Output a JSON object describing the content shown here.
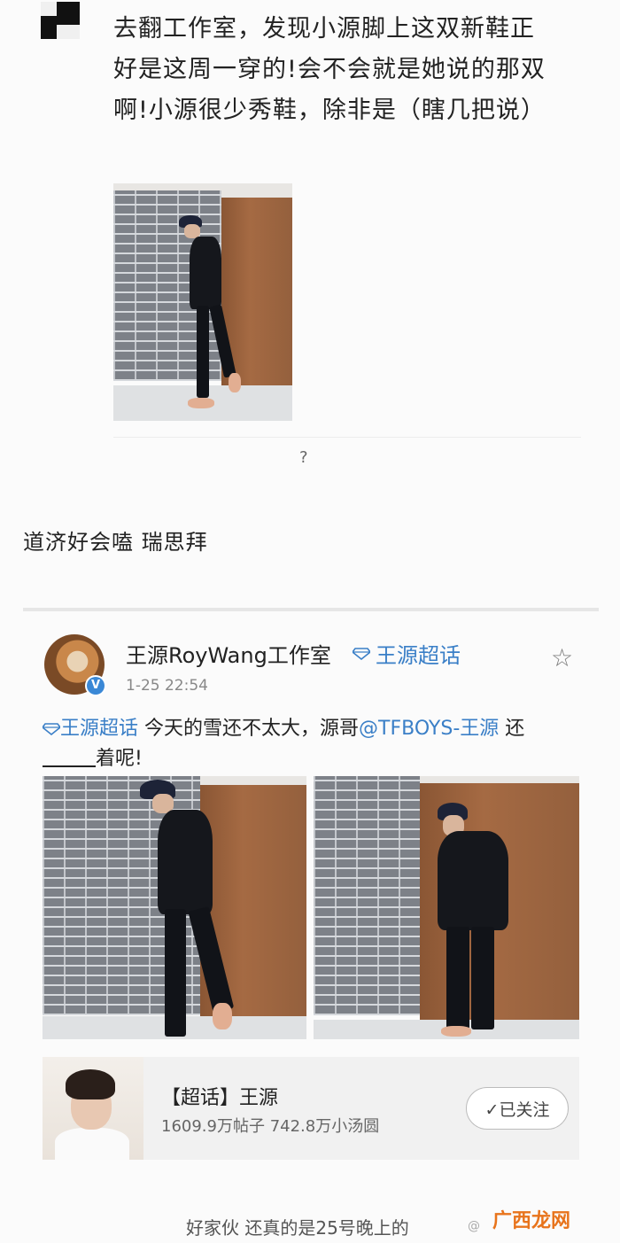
{
  "post": {
    "text": "去翻工作室，发现小源脚上这双新鞋正好是这周一穿的!会不会就是她说的那双啊!小源很少秀鞋，除非是（瞎几把说）",
    "question_mark": "?"
  },
  "comment": {
    "text": "道济好会嗑 瑞思拜"
  },
  "card": {
    "author": "王源RoyWang工作室",
    "topic_label": "王源超话",
    "time": "1-25 22:54",
    "verified_mark": "V",
    "star_glyph": "☆",
    "text_topic": "王源超话",
    "text_part1": " 今天的雪还不太大，源哥",
    "text_mention": "@TFBOYS-王源",
    "text_part2": " 还",
    "text_part3": "着呢!"
  },
  "topic_card": {
    "title": "【超话】王源",
    "stats": "1609.9万帖子 742.8万小汤圆",
    "follow_label": "✓已关注"
  },
  "footer": {
    "text": "好家伙 还真的是25号晚上的"
  },
  "watermark": {
    "text": "广西龙网",
    "sub": "@"
  },
  "colors": {
    "link": "#3a7fc7",
    "watermark": "#e8741c",
    "verified": "#3a88d6"
  }
}
